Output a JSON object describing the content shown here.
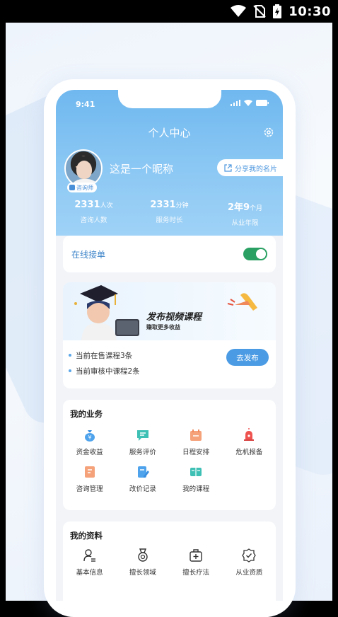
{
  "system_status": {
    "time": "10:30"
  },
  "inner_status": {
    "time": "9:41"
  },
  "header": {
    "title": "个人中心",
    "nickname": "这是一个昵称",
    "badge": "咨询师",
    "share_label": "分享我的名片"
  },
  "stats": [
    {
      "value": "2331",
      "unit": "人次",
      "label": "咨询人数"
    },
    {
      "value": "2331",
      "unit": "分钟",
      "label": "服务时长"
    },
    {
      "value": "2年9",
      "unit": "个月",
      "label": "从业年限"
    }
  ],
  "online": {
    "label": "在线接单",
    "enabled": true
  },
  "promo": {
    "title": "发布视频课程",
    "subtitle": "赚取更多收益",
    "lines": [
      "当前在售课程3条",
      "当前审核中课程2条"
    ],
    "button": "去发布"
  },
  "business": {
    "title": "我的业务",
    "items": [
      {
        "label": "资金收益",
        "icon": "money-bag-icon"
      },
      {
        "label": "服务评价",
        "icon": "comment-icon"
      },
      {
        "label": "日程安排",
        "icon": "calendar-icon"
      },
      {
        "label": "危机报备",
        "icon": "alarm-icon"
      },
      {
        "label": "咨询管理",
        "icon": "document-icon"
      },
      {
        "label": "改价记录",
        "icon": "edit-record-icon"
      },
      {
        "label": "我的课程",
        "icon": "course-icon"
      }
    ]
  },
  "profile": {
    "title": "我的资料",
    "items": [
      {
        "label": "基本信息",
        "icon": "person-info-icon"
      },
      {
        "label": "擅长领域",
        "icon": "medal-icon"
      },
      {
        "label": "擅长疗法",
        "icon": "medical-kit-icon"
      },
      {
        "label": "从业资质",
        "icon": "certificate-icon"
      }
    ]
  },
  "colors": {
    "accent": "#4a9be4",
    "toggle_on": "#2aa163",
    "header": "#6fb8ef"
  }
}
